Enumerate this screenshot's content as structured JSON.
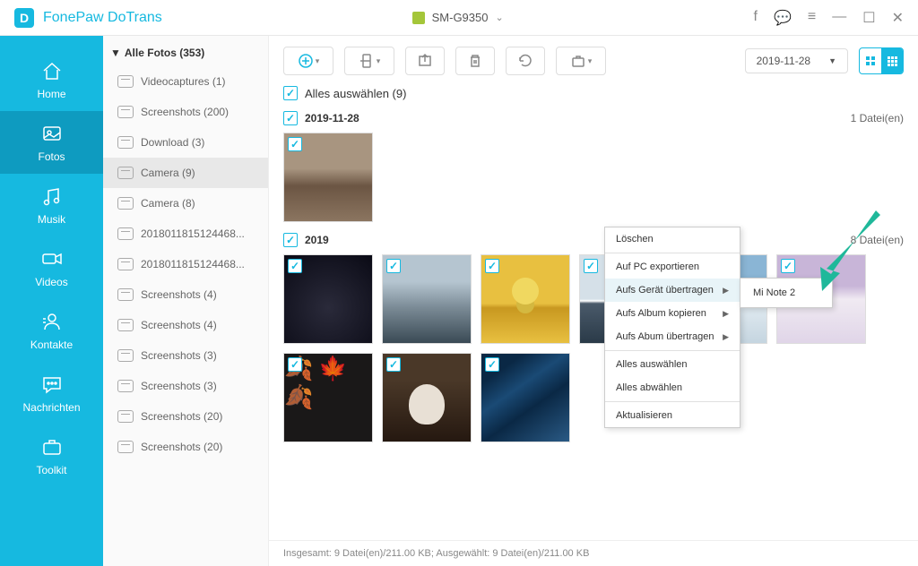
{
  "app": {
    "title": "FonePaw DoTrans"
  },
  "device": {
    "name": "SM-G9350"
  },
  "nav": {
    "home": "Home",
    "fotos": "Fotos",
    "musik": "Musik",
    "videos": "Videos",
    "kontakte": "Kontakte",
    "nachrichten": "Nachrichten",
    "toolkit": "Toolkit"
  },
  "folders": {
    "header": "Alle Fotos (353)",
    "items": [
      "Videocaptures (1)",
      "Screenshots (200)",
      "Download (3)",
      "Camera (9)",
      "Camera (8)",
      "2018011815124468...",
      "2018011815124468...",
      "Screenshots (4)",
      "Screenshots (4)",
      "Screenshots (3)",
      "Screenshots (3)",
      "Screenshots (20)",
      "Screenshots (20)"
    ]
  },
  "toolbar": {
    "date": "2019-11-28"
  },
  "selectAll": "Alles auswählen (9)",
  "sections": [
    {
      "date": "2019-11-28",
      "count": "1 Datei(en)"
    },
    {
      "date": "2019",
      "count": "8 Datei(en)"
    }
  ],
  "contextMenu": {
    "delete": "Löschen",
    "exportPC": "Auf PC exportieren",
    "toDevice": "Aufs Gerät übertragen",
    "copyAlbum": "Aufs Album kopieren",
    "moveAlbum": "Aufs Abum übertragen",
    "selectAll": "Alles auswählen",
    "deselectAll": "Alles abwählen",
    "refresh": "Aktualisieren"
  },
  "submenu": {
    "device": "Mi Note 2"
  },
  "status": "Insgesamt: 9 Datei(en)/211.00 KB; Ausgewählt: 9 Datei(en)/211.00 KB"
}
